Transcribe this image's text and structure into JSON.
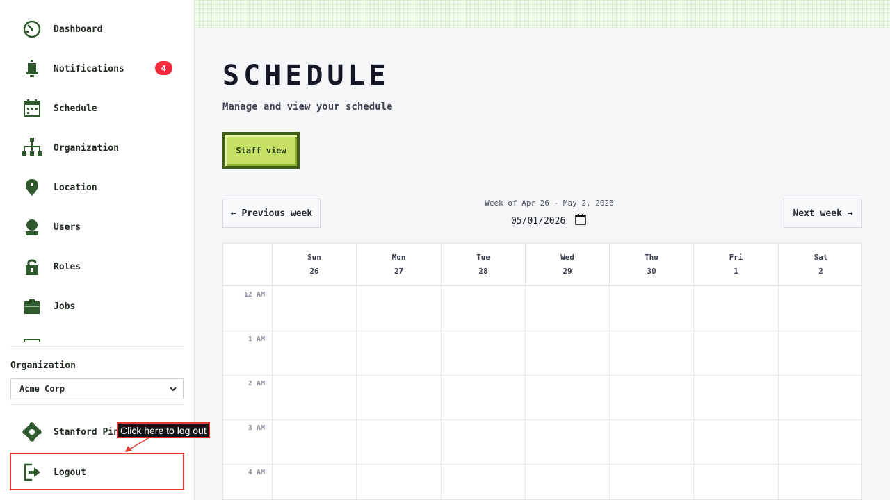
{
  "sidebar": {
    "items": [
      {
        "label": "Dashboard",
        "icon": "dashboard-icon"
      },
      {
        "label": "Notifications",
        "icon": "bell-icon",
        "badge": "4"
      },
      {
        "label": "Schedule",
        "icon": "calendar-icon"
      },
      {
        "label": "Organization",
        "icon": "org-chart-icon"
      },
      {
        "label": "Location",
        "icon": "map-pin-icon"
      },
      {
        "label": "Users",
        "icon": "user-icon"
      },
      {
        "label": "Roles",
        "icon": "lock-icon"
      },
      {
        "label": "Jobs",
        "icon": "briefcase-icon"
      }
    ],
    "organization_label": "Organization",
    "organization_selected": "Acme Corp",
    "user_name": "Stanford Pine",
    "logout_label": "Logout",
    "tooltip": "Click here to log out"
  },
  "main": {
    "title": "SCHEDULE",
    "subtitle": "Manage and view your schedule",
    "staff_view_button": "Staff view",
    "prev_week": "← Previous week",
    "next_week": "Next week →",
    "week_range": "Week of Apr 26 - May 2, 2026",
    "date_value": "05/01/2026"
  },
  "calendar": {
    "days": [
      {
        "name": "Sun",
        "date": "26"
      },
      {
        "name": "Mon",
        "date": "27"
      },
      {
        "name": "Tue",
        "date": "28"
      },
      {
        "name": "Wed",
        "date": "29"
      },
      {
        "name": "Thu",
        "date": "30"
      },
      {
        "name": "Fri",
        "date": "1"
      },
      {
        "name": "Sat",
        "date": "2"
      }
    ],
    "hours": [
      "12 AM",
      "1 AM",
      "2 AM",
      "3 AM",
      "4 AM"
    ]
  },
  "colors": {
    "accent_green": "#3f5e12",
    "button_green": "#c6e066",
    "icon_green": "#2e5a2e",
    "badge_red": "#ef2d3d",
    "highlight_red": "#e53935"
  }
}
